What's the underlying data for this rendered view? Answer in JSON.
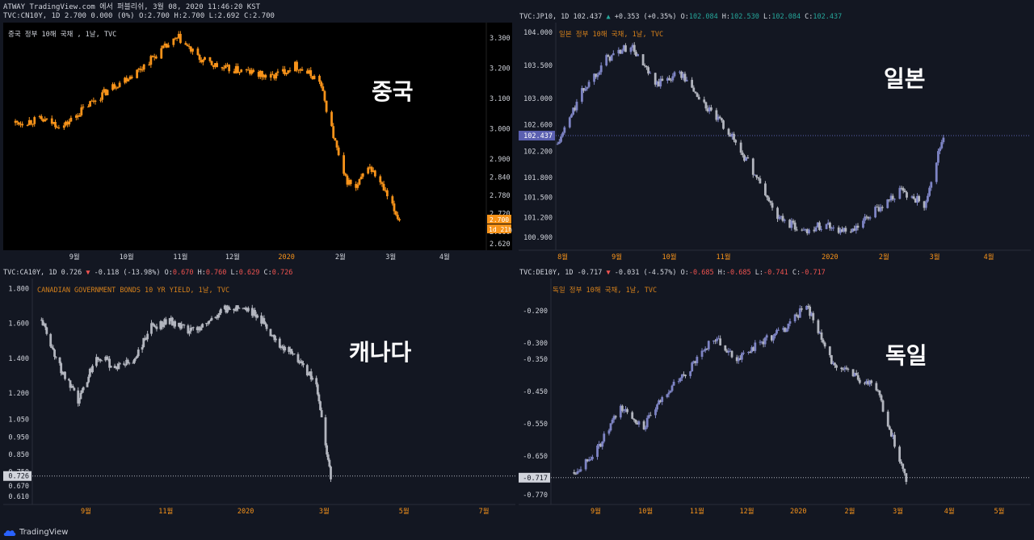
{
  "header": {
    "line1": "ATWAY TradingView.com 에서 퍼블리쉬, 3월 08, 2020 11:46:20 KST",
    "line2": "TVC:CN10Y, 1D 2.700 0.000 (0%) O:2.700 H:2.700 L:2.692 C:2.700"
  },
  "footer": {
    "brand": "TradingView"
  },
  "panels": {
    "cn": {
      "big_label": "중국",
      "title": "중국 정부 10해 국채 , 1날, TVC",
      "price_tag": "2.700",
      "time_tag": "1d 21h",
      "colors": {
        "bg": "#000000",
        "candle": "#f7931a",
        "text": "#d1d4dc",
        "tag": "#f7931a"
      }
    },
    "jp": {
      "big_label": "일본",
      "header": {
        "symbol": "TVC:JP10, 1D 102.437",
        "arrow": "▲",
        "change": "+0.353 (+0.35%)",
        "o": "102.084",
        "h": "102.530",
        "l": "102.084",
        "c": "102.437"
      },
      "title": "일본 정부 10해 국채, 1날, TVC",
      "price_tag": "102.437",
      "colors": {
        "bg": "#131722",
        "candle": "#b2b5be",
        "up": "#7e84c4",
        "tag": "#5b60b1"
      }
    },
    "ca": {
      "big_label": "캐나다",
      "header": {
        "symbol": "TVC:CA10Y, 1D 0.726",
        "arrow": "▼",
        "change": "-0.118 (-13.98%)",
        "o": "0.670",
        "h": "0.760",
        "l": "0.629",
        "c": "0.726"
      },
      "title": "CANADIAN GOVERNMENT BONDS 10 YR YIELD, 1날, TVC",
      "price_tag": "0.726",
      "colors": {
        "bg": "#131722",
        "candle": "#b2b5be",
        "tag": "#d1d4dc"
      }
    },
    "de": {
      "big_label": "독일",
      "header": {
        "symbol": "TVC:DE10Y, 1D -0.717",
        "arrow": "▼",
        "change": "-0.031 (-4.57%)",
        "o": "-0.685",
        "h": "-0.685",
        "l": "-0.741",
        "c": "-0.717"
      },
      "title": "독일 정부 10해 국채, 1날, TVC",
      "price_tag": "-0.717",
      "colors": {
        "bg": "#131722",
        "candle": "#b2b5be",
        "up": "#7e84c4",
        "tag": "#d1d4dc"
      }
    }
  },
  "chart_data": [
    {
      "type": "line",
      "symbol": "TVC:CN10Y",
      "title": "중국 정부 10해 국채 , 1날, TVC",
      "x_ticks": [
        "9월",
        "10월",
        "11월",
        "12월",
        "2020",
        "2월",
        "3월",
        "4월"
      ],
      "y_ticks": [
        "3.300",
        "3.200",
        "3.100",
        "3.000",
        "2.900",
        "2.840",
        "2.780",
        "2.720",
        "2.660",
        "2.620"
      ],
      "ylim": [
        2.62,
        3.33
      ],
      "x": [
        "2019-07-29",
        "2019-08-12",
        "2019-08-26",
        "2019-09-09",
        "2019-09-23",
        "2019-10-07",
        "2019-10-21",
        "2019-10-31",
        "2019-11-12",
        "2019-11-25",
        "2019-12-09",
        "2019-12-23",
        "2020-01-06",
        "2020-01-20",
        "2020-02-03",
        "2020-02-10",
        "2020-02-17",
        "2020-02-24",
        "2020-03-02",
        "2020-03-06"
      ],
      "values": [
        3.02,
        3.03,
        3.01,
        3.08,
        3.14,
        3.19,
        3.26,
        3.3,
        3.23,
        3.2,
        3.19,
        3.17,
        3.21,
        3.16,
        2.84,
        2.8,
        2.88,
        2.82,
        2.74,
        2.7
      ]
    },
    {
      "type": "line",
      "symbol": "TVC:JP10",
      "title": "일본 정부 10해 국채, 1날, TVC",
      "x_ticks": [
        "8월",
        "9월",
        "10월",
        "11월",
        "2020",
        "2월",
        "3월",
        "4월"
      ],
      "y_ticks": [
        "104.000",
        "103.500",
        "103.000",
        "102.600",
        "102.200",
        "101.800",
        "101.500",
        "101.200",
        "100.900"
      ],
      "ylim": [
        100.8,
        104.05
      ],
      "x": [
        "2019-07-29",
        "2019-08-12",
        "2019-08-26",
        "2019-09-09",
        "2019-09-23",
        "2019-10-07",
        "2019-10-21",
        "2019-11-04",
        "2019-11-18",
        "2019-12-02",
        "2019-12-16",
        "2019-12-30",
        "2020-01-13",
        "2020-01-27",
        "2020-02-10",
        "2020-02-24",
        "2020-03-06"
      ],
      "values": [
        102.3,
        103.1,
        103.6,
        103.8,
        103.2,
        103.4,
        102.9,
        102.5,
        101.9,
        101.2,
        101.0,
        101.1,
        100.95,
        101.3,
        101.6,
        101.4,
        102.437
      ]
    },
    {
      "type": "line",
      "symbol": "TVC:CA10Y",
      "title": "CANADIAN GOVERNMENT BONDS 10 YR YIELD, 1날, TVC",
      "x_ticks": [
        "9월",
        "11월",
        "2020",
        "3월",
        "5월",
        "7월"
      ],
      "y_ticks": [
        "1.800",
        "1.600",
        "1.400",
        "1.200",
        "1.050",
        "0.950",
        "0.850",
        "0.750",
        "0.670",
        "0.610"
      ],
      "ylim": [
        0.6,
        1.82
      ],
      "x": [
        "2019-07-29",
        "2019-08-12",
        "2019-08-26",
        "2019-09-09",
        "2019-09-23",
        "2019-10-07",
        "2019-10-21",
        "2019-11-04",
        "2019-11-18",
        "2019-12-02",
        "2019-12-16",
        "2019-12-30",
        "2020-01-13",
        "2020-01-27",
        "2020-02-10",
        "2020-02-24",
        "2020-03-02",
        "2020-03-06"
      ],
      "values": [
        1.62,
        1.35,
        1.15,
        1.42,
        1.35,
        1.38,
        1.58,
        1.62,
        1.55,
        1.6,
        1.68,
        1.7,
        1.62,
        1.48,
        1.4,
        1.25,
        0.9,
        0.726
      ]
    },
    {
      "type": "line",
      "symbol": "TVC:DE10Y",
      "title": "독일 정부 10해 국채, 1날, TVC",
      "x_ticks": [
        "9월",
        "10월",
        "11월",
        "12월",
        "2020",
        "2월",
        "3월",
        "4월",
        "5월"
      ],
      "y_ticks": [
        "-0.200",
        "-0.300",
        "-0.350",
        "-0.450",
        "-0.550",
        "-0.650",
        "-0.770"
      ],
      "ylim": [
        -0.78,
        -0.12
      ],
      "x": [
        "2019-08-19",
        "2019-09-02",
        "2019-09-16",
        "2019-09-30",
        "2019-10-14",
        "2019-10-28",
        "2019-11-11",
        "2019-11-25",
        "2019-12-09",
        "2019-12-23",
        "2020-01-06",
        "2020-01-20",
        "2020-02-03",
        "2020-02-17",
        "2020-03-02",
        "2020-03-06"
      ],
      "values": [
        -0.7,
        -0.63,
        -0.5,
        -0.56,
        -0.45,
        -0.38,
        -0.28,
        -0.35,
        -0.3,
        -0.26,
        -0.18,
        -0.35,
        -0.4,
        -0.44,
        -0.66,
        -0.717
      ]
    }
  ]
}
